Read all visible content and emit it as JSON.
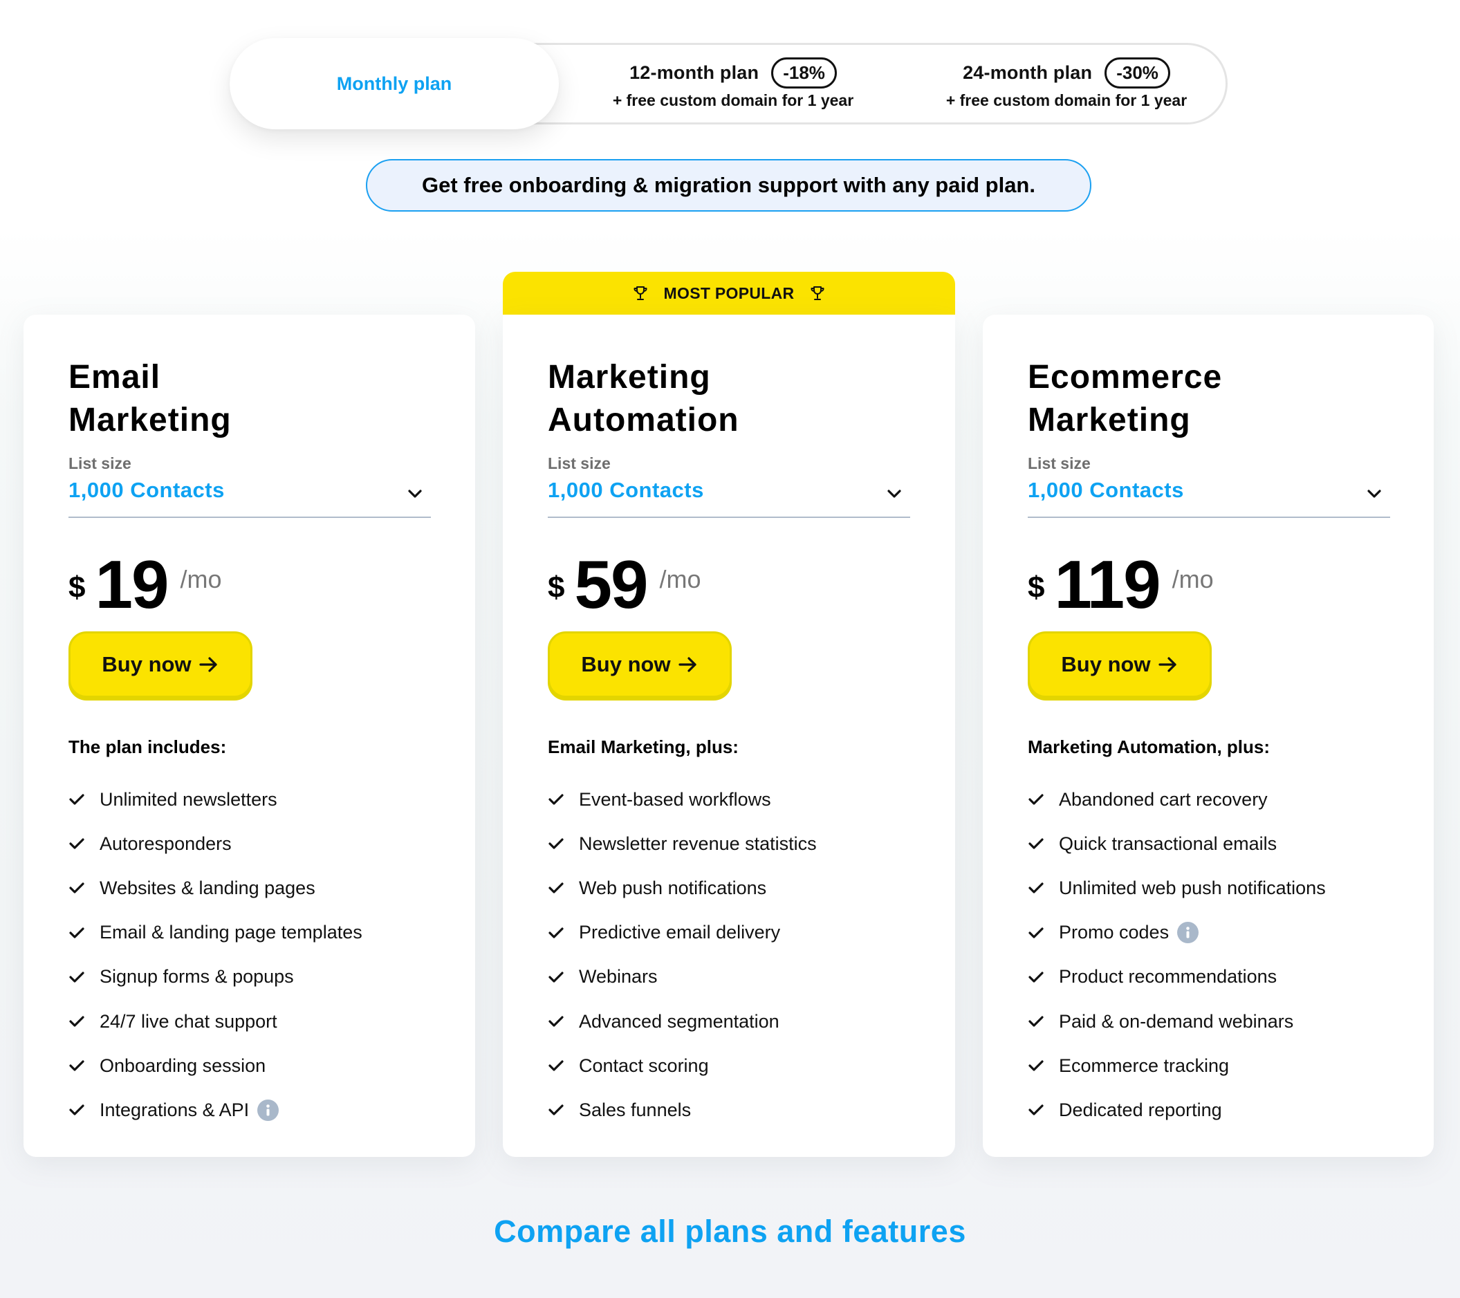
{
  "billing_toggle": {
    "monthly_label": "Monthly plan",
    "options": [
      {
        "label": "12-month plan",
        "discount": "-18%",
        "perk": "+ free custom domain for 1 year"
      },
      {
        "label": "24-month plan",
        "discount": "-30%",
        "perk": "+ free custom domain for 1 year"
      }
    ],
    "selected": "Monthly plan"
  },
  "onboarding_banner": "Get free onboarding & migration support with any paid plan.",
  "popular_badge": "MOST POPULAR",
  "plans": [
    {
      "title_line1": "Email",
      "title_line2": "Marketing",
      "list_size_label": "List size",
      "list_size_value": "1,000 Contacts",
      "currency": "$",
      "price": "19",
      "period": "/mo",
      "cta": "Buy now",
      "includes_title": "The plan includes:",
      "features": [
        {
          "text": "Unlimited newsletters",
          "info": false
        },
        {
          "text": "Autoresponders",
          "info": false
        },
        {
          "text": "Websites & landing pages",
          "info": false
        },
        {
          "text": "Email & landing page templates",
          "info": false
        },
        {
          "text": "Signup forms & popups",
          "info": false
        },
        {
          "text": "24/7 live chat support",
          "info": false
        },
        {
          "text": "Onboarding session",
          "info": false
        },
        {
          "text": "Integrations & API",
          "info": true
        }
      ]
    },
    {
      "title_line1": "Marketing",
      "title_line2": "Automation",
      "list_size_label": "List size",
      "list_size_value": "1,000 Contacts",
      "currency": "$",
      "price": "59",
      "period": "/mo",
      "cta": "Buy now",
      "includes_title": "Email Marketing, plus:",
      "features": [
        {
          "text": "Event-based workflows",
          "info": false
        },
        {
          "text": "Newsletter revenue statistics",
          "info": false
        },
        {
          "text": "Web push notifications",
          "info": false
        },
        {
          "text": "Predictive email delivery",
          "info": false
        },
        {
          "text": "Webinars",
          "info": false
        },
        {
          "text": "Advanced segmentation",
          "info": false
        },
        {
          "text": "Contact scoring",
          "info": false
        },
        {
          "text": "Sales funnels",
          "info": false
        }
      ]
    },
    {
      "title_line1": "Ecommerce",
      "title_line2": "Marketing",
      "list_size_label": "List size",
      "list_size_value": "1,000 Contacts",
      "currency": "$",
      "price": "119",
      "period": "/mo",
      "cta": "Buy now",
      "includes_title": "Marketing Automation, plus:",
      "features": [
        {
          "text": "Abandoned cart recovery",
          "info": false
        },
        {
          "text": "Quick transactional emails",
          "info": false
        },
        {
          "text": "Unlimited web push notifications",
          "info": false
        },
        {
          "text": "Promo codes",
          "info": true
        },
        {
          "text": "Product recommendations",
          "info": false
        },
        {
          "text": "Paid & on-demand webinars",
          "info": false
        },
        {
          "text": "Ecommerce tracking",
          "info": false
        },
        {
          "text": "Dedicated reporting",
          "info": false
        }
      ]
    }
  ],
  "compare_link": "Compare all plans and features",
  "colors": {
    "accent_blue": "#0ea2f2",
    "cta_yellow": "#fbe300",
    "banner_bg": "#ebf2fd",
    "info_icon": "#a9b8ca"
  },
  "icons": {
    "popular": "trophy-icon",
    "dropdown": "chevron-down-icon",
    "cta": "arrow-right-icon",
    "feature": "check-icon",
    "info": "info-icon"
  }
}
